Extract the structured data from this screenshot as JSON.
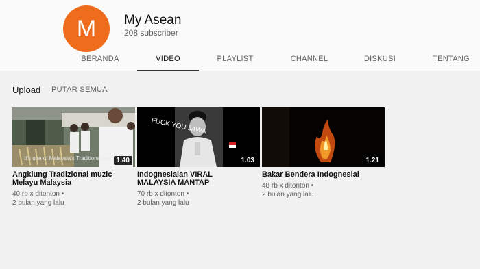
{
  "channel": {
    "avatar_letter": "M",
    "avatar_color": "#ef6c1c",
    "name": "My Asean",
    "subscribers": "208 subscriber"
  },
  "tabs": [
    {
      "label": "BERANDA",
      "active": false
    },
    {
      "label": "VIDEO",
      "active": true
    },
    {
      "label": "PLAYLIST",
      "active": false
    },
    {
      "label": "CHANNEL",
      "active": false
    },
    {
      "label": "DISKUSI",
      "active": false
    },
    {
      "label": "TENTANG",
      "active": false
    }
  ],
  "section": {
    "title": "Upload",
    "play_all": "PUTAR SEMUA"
  },
  "videos": [
    {
      "title_line1": "Angklung Tradizional muzic",
      "title_line2": "Melayu Malaysia",
      "views": "40 rb x ditonton",
      "age": "2 bulan yang lalu",
      "duration": "1.40",
      "thumb_caption": "It's one of Malaysia's Traditional Ins..."
    },
    {
      "title_line1": "Indognesialan VIRAL",
      "title_line2": "MALAYSIA MANTAP",
      "views": "70 rb x ditonton",
      "age": "2 bulan yang lalu",
      "duration": "1.03",
      "thumb_caption": "FUCK YOU JAWA"
    },
    {
      "title_line1": "Bakar Bendera Indognesial",
      "title_line2": "",
      "views": "48 rb x ditonton",
      "age": "2 bulan yang lalu",
      "duration": "1.21",
      "thumb_caption": ""
    }
  ]
}
